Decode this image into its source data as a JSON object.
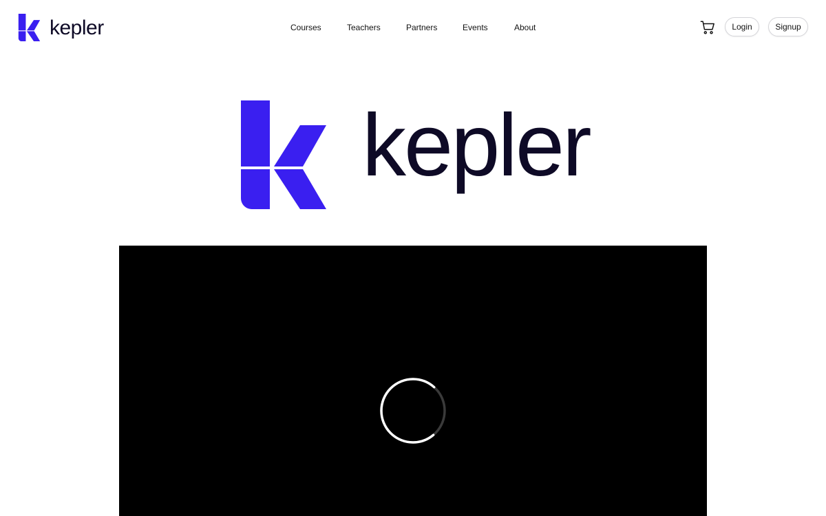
{
  "brand": {
    "name": "kepler",
    "accent_color": "#3a1ff0",
    "text_color": "#0e0a26"
  },
  "nav": {
    "items": [
      {
        "label": "Courses"
      },
      {
        "label": "Teachers"
      },
      {
        "label": "Partners"
      },
      {
        "label": "Events"
      },
      {
        "label": "About"
      }
    ]
  },
  "actions": {
    "cart_icon": "shopping-cart-icon",
    "login_label": "Login",
    "signup_label": "Signup"
  },
  "hero": {
    "logo_word": "kepler"
  },
  "video": {
    "state_icon": "loading-spinner-icon",
    "background": "#000000"
  }
}
